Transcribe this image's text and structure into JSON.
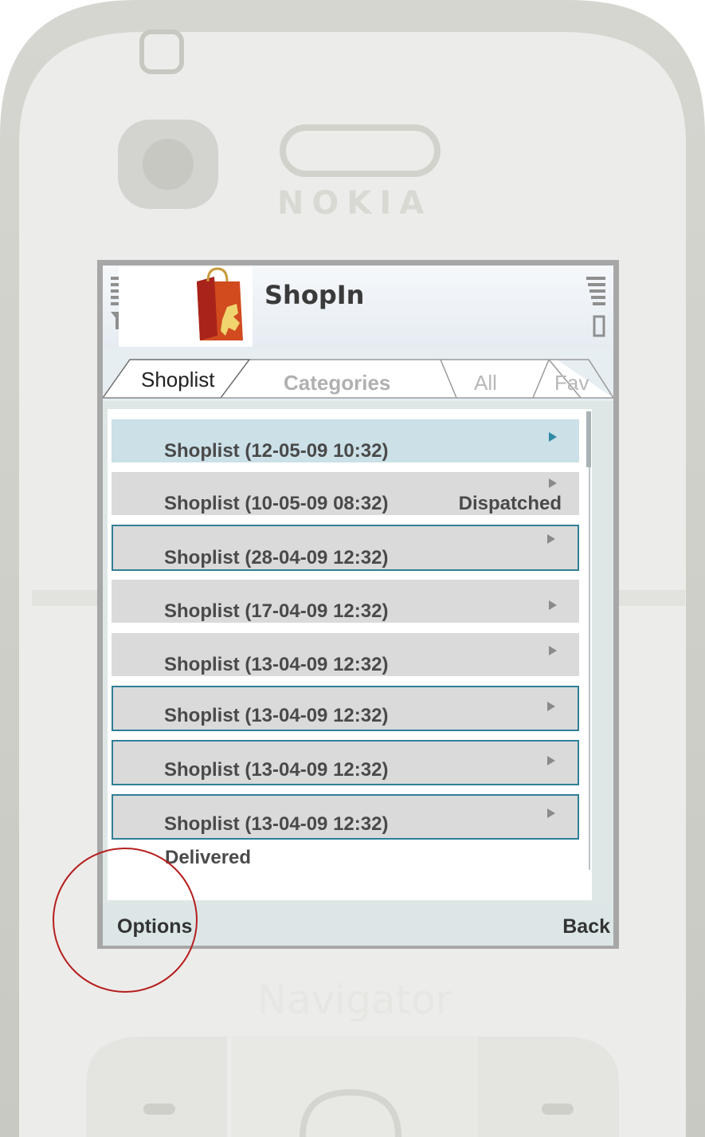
{
  "device": {
    "brand": "NOKIA",
    "nav_label": "Navigator"
  },
  "app": {
    "title": "ShopIn",
    "logo_icon": "shopping-bag-icon"
  },
  "tabs": [
    {
      "label": "Shoplist",
      "active": true
    },
    {
      "label": "Categories",
      "active": false
    },
    {
      "label": "All",
      "active": false
    },
    {
      "label": "Fav",
      "active": false
    }
  ],
  "list": {
    "items": [
      {
        "label": "Shoplist (12-05-09 10:32)",
        "status": "",
        "state": "selected"
      },
      {
        "label": "Shoplist (10-05-09 08:32)",
        "status": "Dispatched",
        "state": "normal"
      },
      {
        "label": "Shoplist (28-04-09 12:32)",
        "status": "",
        "state": "outlined"
      },
      {
        "label": "Shoplist (17-04-09 12:32)",
        "status": "",
        "state": "normal"
      },
      {
        "label": "Shoplist (13-04-09 12:32)",
        "status": "",
        "state": "normal"
      },
      {
        "label": "Shoplist (13-04-09 12:32)",
        "status": "",
        "state": "outlined"
      },
      {
        "label": "Shoplist (13-04-09 12:32)",
        "status": "",
        "state": "outlined"
      },
      {
        "label": "Shoplist (13-04-09 12:32)",
        "status": "",
        "state": "outlined"
      }
    ],
    "footer_text": "Delivered"
  },
  "softkeys": {
    "left": "Options",
    "right": "Back"
  },
  "colors": {
    "selected_row": "#cbe0e7",
    "outline": "#2f7f96",
    "annotation_circle": "#b51e1e"
  }
}
